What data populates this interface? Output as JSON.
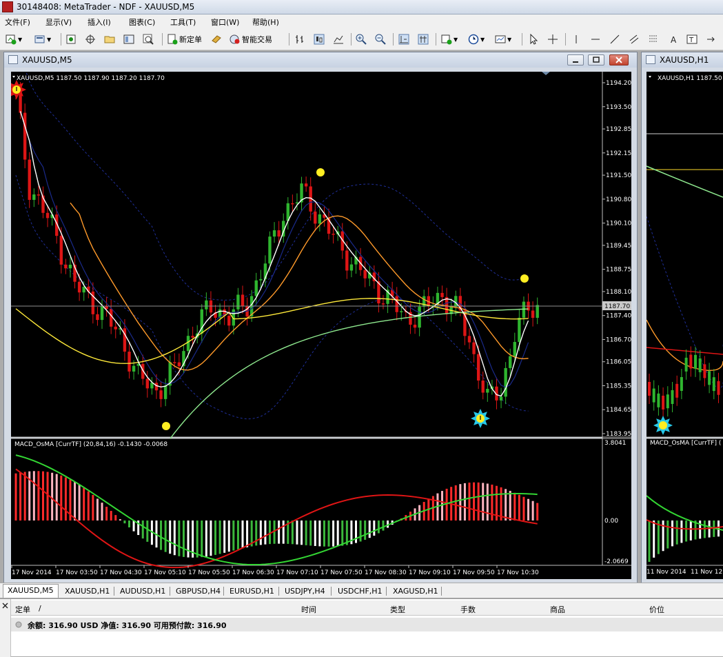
{
  "window": {
    "title": "30148408: MetaTrader - NDF - XAUUSD,M5"
  },
  "menu": [
    "文件(F)",
    "显示(V)",
    "插入(I)",
    "图表(C)",
    "工具(T)",
    "窗口(W)",
    "帮助(H)"
  ],
  "toolbar": {
    "new_order": "新定单",
    "auto_trading": "智能交易"
  },
  "chart_window": {
    "title": "XAUUSD,M5"
  },
  "chart_window2": {
    "title": "XAUUSD,H1"
  },
  "main_chart": {
    "symbol_info": "XAUUSD,M5  1187.50 1187.90 1187.20 1187.70",
    "price_ticks": [
      "1194.20",
      "1193.50",
      "1192.85",
      "1192.15",
      "1191.50",
      "1190.80",
      "1190.10",
      "1189.45",
      "1188.75",
      "1188.10",
      "1187.40",
      "1186.70",
      "1186.05",
      "1185.35",
      "1184.65",
      "1183.95"
    ],
    "current_price": "1187.70",
    "indicator_label": "MACD_OsMA [CurrTF] (20,84,16) -0.1430 -0.0068",
    "indicator_ticks": [
      "3.8041",
      "0.00",
      "-2.0669"
    ],
    "time_ticks": [
      "17 Nov 2014",
      "17 Nov 03:50",
      "17 Nov 04:30",
      "17 Nov 05:10",
      "17 Nov 05:50",
      "17 Nov 06:30",
      "17 Nov 07:10",
      "17 Nov 07:50",
      "17 Nov 08:30",
      "17 Nov 09:10",
      "17 Nov 09:50",
      "17 Nov 10:30"
    ]
  },
  "second_chart": {
    "symbol_info": "XAUUSD,H1  1187.50",
    "indicator_label": "MACD_OsMA [CurrTF] (",
    "time_ticks": [
      "11 Nov 2014",
      "11 Nov 12:"
    ]
  },
  "tabs": [
    "XAUUSD,M5",
    "XAUUSD,H1",
    "AUDUSD,H1",
    "GBPUSD,H4",
    "EURUSD,H1",
    "USDJPY,H4",
    "USDCHF,H1",
    "XAGUSD,H1"
  ],
  "terminal": {
    "columns": [
      "定单",
      "/",
      "时间",
      "类型",
      "手数",
      "商品",
      "价位"
    ],
    "balance_line": "余额: 316.90 USD  净值: 316.90  可用预付款: 316.90"
  },
  "colors": {
    "bull": "#2fb52f",
    "bear": "#dd1515",
    "chart_bg": "#000000",
    "macd_up": "#ffb6c1",
    "macd_dn": "#ffffff"
  }
}
